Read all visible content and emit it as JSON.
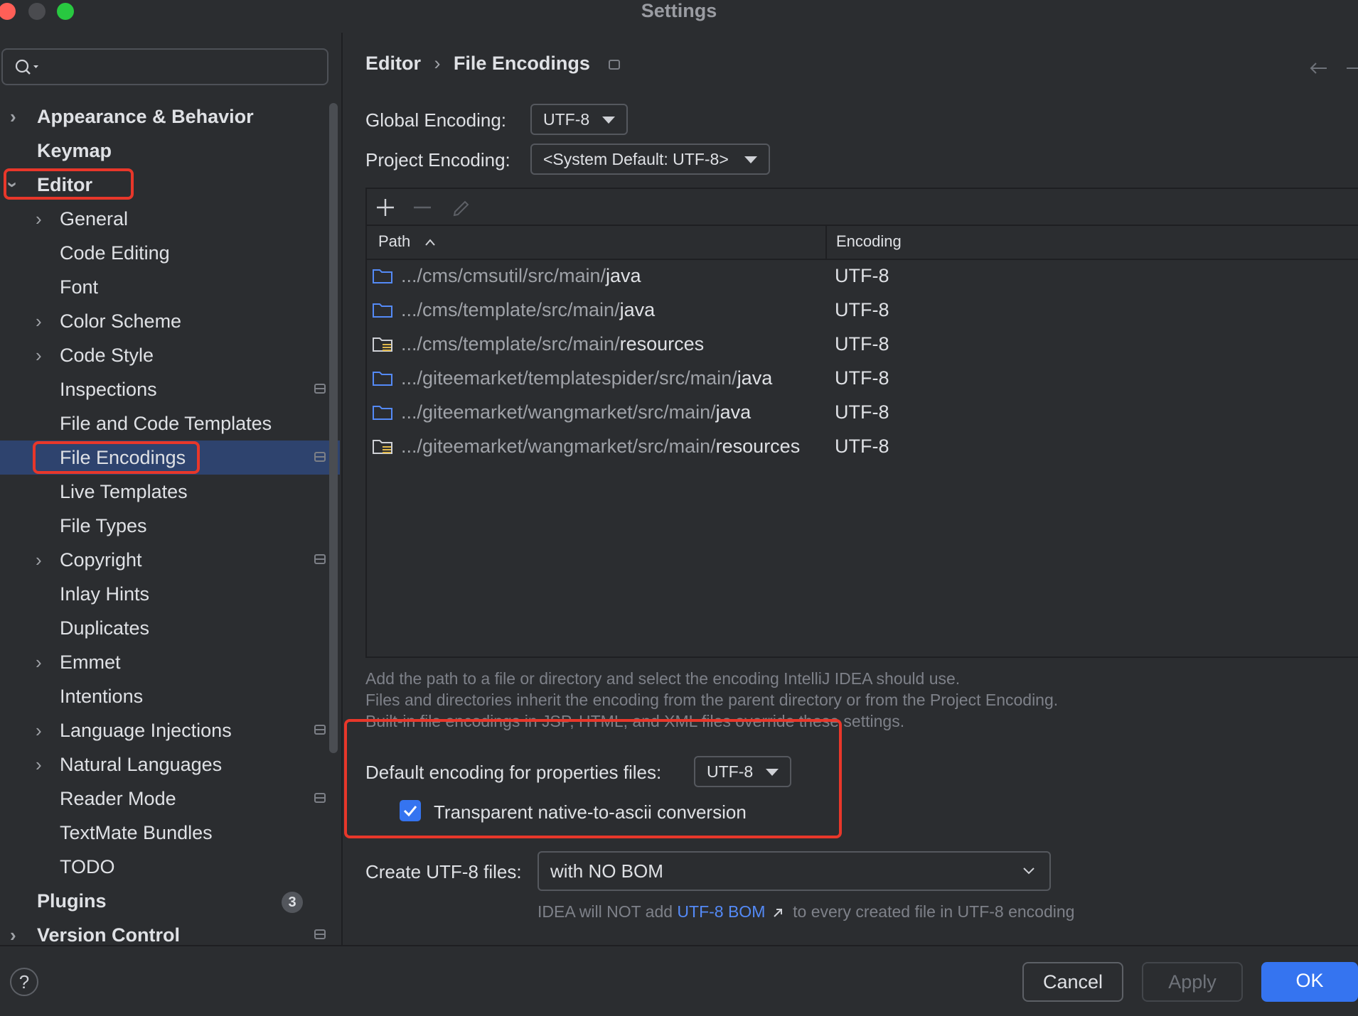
{
  "window": {
    "title": "Settings"
  },
  "sidebar": {
    "search_placeholder": "",
    "items": [
      {
        "label": "Appearance & Behavior"
      },
      {
        "label": "Keymap"
      },
      {
        "label": "Editor"
      },
      {
        "label": "General"
      },
      {
        "label": "Code Editing"
      },
      {
        "label": "Font"
      },
      {
        "label": "Color Scheme"
      },
      {
        "label": "Code Style"
      },
      {
        "label": "Inspections"
      },
      {
        "label": "File and Code Templates"
      },
      {
        "label": "File Encodings"
      },
      {
        "label": "Live Templates"
      },
      {
        "label": "File Types"
      },
      {
        "label": "Copyright"
      },
      {
        "label": "Inlay Hints"
      },
      {
        "label": "Duplicates"
      },
      {
        "label": "Emmet"
      },
      {
        "label": "Intentions"
      },
      {
        "label": "Language Injections"
      },
      {
        "label": "Natural Languages"
      },
      {
        "label": "Reader Mode"
      },
      {
        "label": "TextMate Bundles"
      },
      {
        "label": "TODO"
      },
      {
        "label": "Plugins",
        "badge": "3"
      },
      {
        "label": "Version Control"
      }
    ]
  },
  "header": {
    "breadcrumb_parent": "Editor",
    "breadcrumb_sep": "›",
    "breadcrumb_current": "File Encodings"
  },
  "encodings": {
    "global_label": "Global Encoding:",
    "global_value": "UTF-8",
    "project_label": "Project Encoding:",
    "project_value": "<System Default: UTF-8>"
  },
  "table": {
    "columns": {
      "path": "Path",
      "encoding": "Encoding"
    },
    "rows": [
      {
        "dim": ".../cms/cmsutil/src/main/",
        "em": "java",
        "encoding": "UTF-8",
        "icon": "folder-icon"
      },
      {
        "dim": ".../cms/template/src/main/",
        "em": "java",
        "encoding": "UTF-8",
        "icon": "folder-icon"
      },
      {
        "dim": ".../cms/template/src/main/",
        "em": "resources",
        "encoding": "UTF-8",
        "icon": "resources-folder-icon"
      },
      {
        "dim": ".../giteemarket/templatespider/src/main/",
        "em": "java",
        "encoding": "UTF-8",
        "icon": "folder-icon"
      },
      {
        "dim": ".../giteemarket/wangmarket/src/main/",
        "em": "java",
        "encoding": "UTF-8",
        "icon": "folder-icon"
      },
      {
        "dim": ".../giteemarket/wangmarket/src/main/",
        "em": "resources",
        "encoding": "UTF-8",
        "icon": "resources-folder-icon"
      }
    ]
  },
  "help": {
    "line1": "Add the path to a file or directory and select the encoding IntelliJ IDEA should use.",
    "line2": "Files and directories inherit the encoding from the parent directory or from the Project Encoding.",
    "line3": "Built-in file encodings in JSP, HTML, and XML files override these settings."
  },
  "properties": {
    "label": "Default encoding for properties files:",
    "value": "UTF-8",
    "checkbox_label": "Transparent native-to-ascii conversion",
    "checked": true
  },
  "bom": {
    "label": "Create UTF-8 files:",
    "value": "with NO BOM",
    "note_prefix": "IDEA will NOT add",
    "note_link": "UTF-8 BOM",
    "note_suffix": "to every created file in UTF-8 encoding"
  },
  "footer": {
    "help": "?",
    "cancel": "Cancel",
    "apply": "Apply",
    "ok": "OK"
  },
  "colors": {
    "accent": "#3574f0",
    "selection": "#2e436e",
    "highlight_box": "#e8372a",
    "link": "#548af7",
    "folder": "#548af7"
  }
}
